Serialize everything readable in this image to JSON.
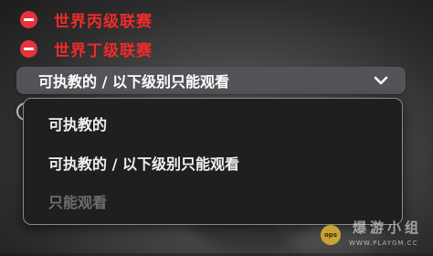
{
  "league_rows": [
    {
      "label": "世界丙级联赛"
    },
    {
      "label": "世界丁级联赛"
    }
  ],
  "permission_select": {
    "selected": "可执教的 / 以下级别只能观看",
    "options": [
      {
        "label": "可执教的",
        "enabled": true
      },
      {
        "label": "可执教的 / 以下级别只能观看",
        "enabled": true
      },
      {
        "label": "只能观看",
        "enabled": false
      }
    ]
  },
  "watermark": {
    "badge": "ops",
    "title": "爆游小组",
    "url": "WWW.PLAYGM.CC"
  },
  "colors": {
    "remove_red": "#e8323c",
    "league_text_red": "#ee2b2b",
    "select_bg": "#535458",
    "dropdown_bg": "#1f1f20",
    "disabled_text": "#6e6e6e"
  }
}
